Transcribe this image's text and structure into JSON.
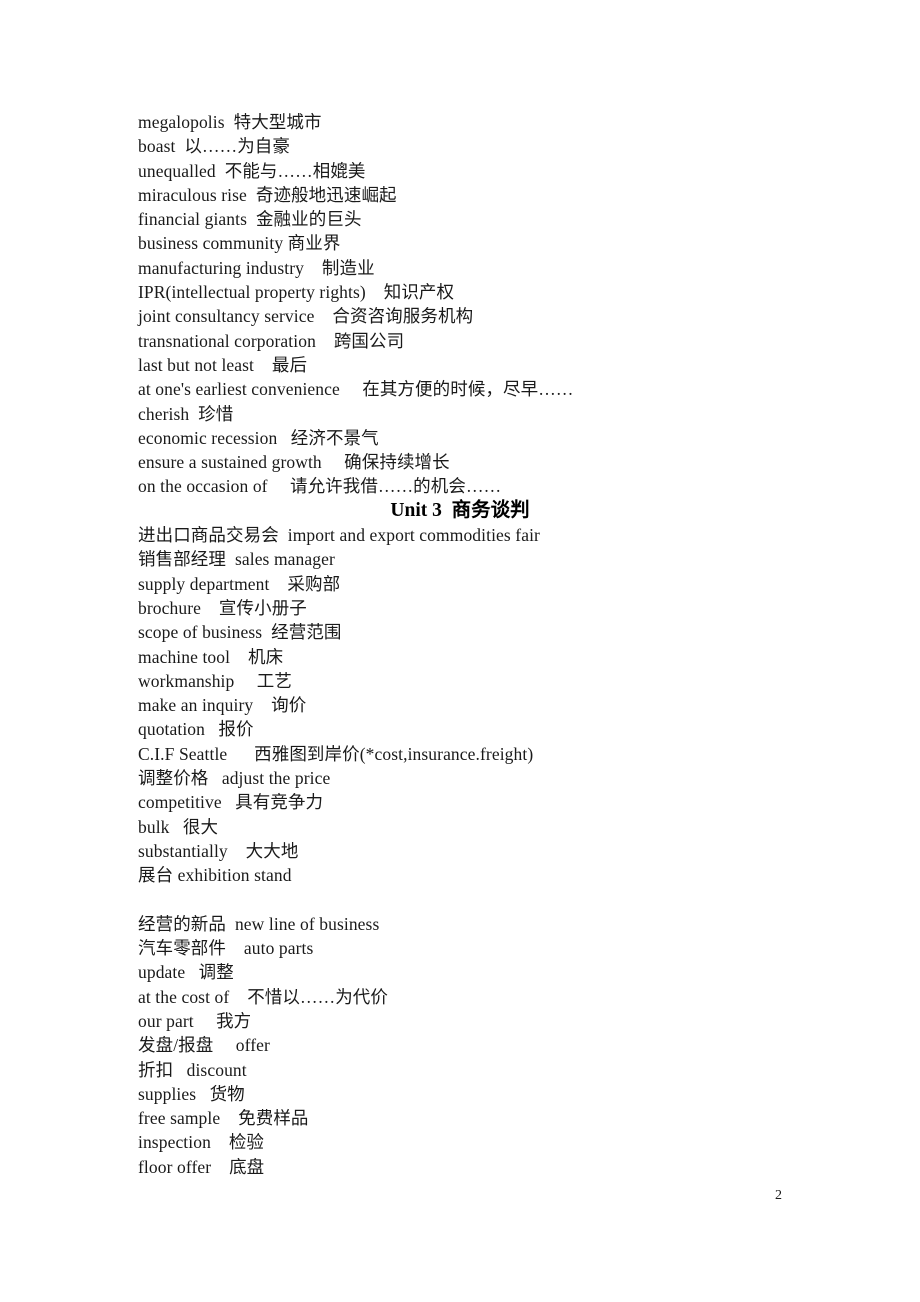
{
  "document": {
    "page_number": "2",
    "blocks": [
      {
        "type": "line",
        "text": "megalopolis  特大型城市"
      },
      {
        "type": "line",
        "text": "boast  以……为自豪"
      },
      {
        "type": "line",
        "text": "unequalled  不能与……相媲美"
      },
      {
        "type": "line",
        "text": "miraculous rise  奇迹般地迅速崛起"
      },
      {
        "type": "line",
        "text": "financial giants  金融业的巨头"
      },
      {
        "type": "line",
        "text": "business community 商业界"
      },
      {
        "type": "line",
        "text": "manufacturing industry    制造业"
      },
      {
        "type": "line",
        "text": "IPR(intellectual property rights)    知识产权"
      },
      {
        "type": "line",
        "text": "joint consultancy service    合资咨询服务机构"
      },
      {
        "type": "line",
        "text": "transnational corporation    跨国公司"
      },
      {
        "type": "line",
        "text": "last but not least    最后"
      },
      {
        "type": "line",
        "text": "at one's earliest convenience     在其方便的时候，尽早……"
      },
      {
        "type": "line",
        "text": "cherish  珍惜"
      },
      {
        "type": "line",
        "text": "economic recession   经济不景气"
      },
      {
        "type": "line",
        "text": "ensure a sustained growth     确保持续增长"
      },
      {
        "type": "line",
        "text": "on the occasion of     请允许我借……的机会……"
      },
      {
        "type": "heading",
        "text": "Unit 3  商务谈判"
      },
      {
        "type": "line",
        "text": "进出口商品交易会  import and export commodities fair"
      },
      {
        "type": "line",
        "text": "销售部经理  sales manager"
      },
      {
        "type": "line",
        "text": "supply department    采购部"
      },
      {
        "type": "line",
        "text": "brochure    宣传小册子"
      },
      {
        "type": "line",
        "text": "scope of business  经营范围"
      },
      {
        "type": "line",
        "text": "machine tool    机床"
      },
      {
        "type": "line",
        "text": "workmanship     工艺"
      },
      {
        "type": "line",
        "text": "make an inquiry    询价"
      },
      {
        "type": "line",
        "text": "quotation   报价"
      },
      {
        "type": "line",
        "text": "C.I.F Seattle      西雅图到岸价(*cost,insurance.freight)"
      },
      {
        "type": "line",
        "text": "调整价格   adjust the price"
      },
      {
        "type": "line",
        "text": "competitive   具有竞争力"
      },
      {
        "type": "line",
        "text": "bulk   很大"
      },
      {
        "type": "line",
        "text": "substantially    大大地"
      },
      {
        "type": "line",
        "text": "展台 exhibition stand"
      },
      {
        "type": "blank",
        "text": ""
      },
      {
        "type": "line",
        "text": "经营的新品  new line of business"
      },
      {
        "type": "line",
        "text": "汽车零部件    auto parts"
      },
      {
        "type": "line",
        "text": "update   调整"
      },
      {
        "type": "line",
        "text": "at the cost of    不惜以……为代价"
      },
      {
        "type": "line",
        "text": "our part     我方"
      },
      {
        "type": "line",
        "text": "发盘/报盘     offer"
      },
      {
        "type": "line",
        "text": "折扣   discount"
      },
      {
        "type": "line",
        "text": "supplies   货物"
      },
      {
        "type": "line",
        "text": "free sample    免费样品"
      },
      {
        "type": "line",
        "text": "inspection    检验"
      },
      {
        "type": "line",
        "text": "floor offer    底盘"
      }
    ]
  }
}
